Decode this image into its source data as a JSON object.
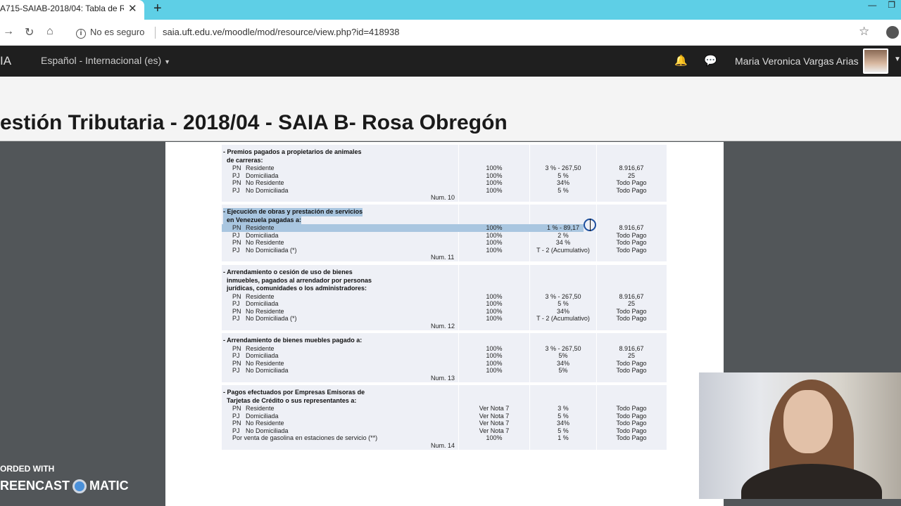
{
  "browser": {
    "tab_title": "A715-SAIAB-2018/04: Tabla de R",
    "secure_label": "No es seguro",
    "url": "saia.uft.edu.ve/moodle/mod/resource/view.php?id=418938"
  },
  "navbar": {
    "brand": "IA",
    "language": "Español - Internacional (es)",
    "user_name": "Maria Veronica Vargas Arias"
  },
  "course": {
    "title": "estión Tributaria - 2018/04 - SAIA B- Rosa Obregón"
  },
  "document": {
    "blocks": [
      {
        "heading": [
          "- Premios pagados a propietarios de animales",
          "de carreras:"
        ],
        "rows": [
          {
            "pfx": "PN",
            "label": "Residente",
            "c1": "100%",
            "c2": "3  %  - 267,50",
            "c3": "8.916,67"
          },
          {
            "pfx": "PJ",
            "label": "Domiciliada",
            "c1": "100%",
            "c2": "5  %",
            "c3": "25"
          },
          {
            "pfx": "PN",
            "label": "No Residente",
            "c1": "100%",
            "c2": "34%",
            "c3": "Todo Pago"
          },
          {
            "pfx": "PJ",
            "label": "No Domiciliada",
            "c1": "100%",
            "c2": "5  %",
            "c3": "Todo Pago"
          }
        ],
        "num": "Num. 10"
      },
      {
        "heading": [
          "- Ejecución de obras y prestación de servicios",
          "en Venezuela pagadas a:"
        ],
        "rows": [
          {
            "pfx": "PN",
            "label": "Residente",
            "c1": "100%",
            "c2": "1 %  - 89,17",
            "c3": "8.916,67"
          },
          {
            "pfx": "PJ",
            "label": "Domiciliada",
            "c1": "100%",
            "c2": "2  %",
            "c3": "Todo Pago"
          },
          {
            "pfx": "PN",
            "label": "No Residente",
            "c1": "100%",
            "c2": "34 %",
            "c3": "Todo Pago"
          },
          {
            "pfx": "PJ",
            "label": "No Domiciliada     (*)",
            "c1": "100%",
            "c2": "T  - 2 (Acumulativo)",
            "c3": "Todo Pago"
          }
        ],
        "num": "Num. 11"
      },
      {
        "heading": [
          "- Arrendamiento o cesión de uso de bienes",
          "inmuebles, pagados al arrendador por personas",
          "jurídicas, comunidades o los administradores:"
        ],
        "rows": [
          {
            "pfx": "PN",
            "label": "Residente",
            "c1": "100%",
            "c2": "3  %  - 267,50",
            "c3": "8.916,67"
          },
          {
            "pfx": "PJ",
            "label": "Domiciliada",
            "c1": "100%",
            "c2": "5  %",
            "c3": "25"
          },
          {
            "pfx": "PN",
            "label": "No Residente",
            "c1": "100%",
            "c2": "34%",
            "c3": "Todo Pago"
          },
          {
            "pfx": "PJ",
            "label": "No Domiciliada     (*)",
            "c1": "100%",
            "c2": "T  - 2 (Acumulativo)",
            "c3": "Todo Pago"
          }
        ],
        "num": "Num. 12"
      },
      {
        "heading": [
          "- Arrendamiento de bienes muebles pagado a:"
        ],
        "rows": [
          {
            "pfx": "PN",
            "label": "Residente",
            "c1": "100%",
            "c2": "3  %  - 267,50",
            "c3": "8.916,67"
          },
          {
            "pfx": "PJ",
            "label": "Domiciliada",
            "c1": "100%",
            "c2": "5%",
            "c3": "25"
          },
          {
            "pfx": "PN",
            "label": "No Residente",
            "c1": "100%",
            "c2": "34%",
            "c3": "Todo Pago"
          },
          {
            "pfx": "PJ",
            "label": "No Domiciliada",
            "c1": "100%",
            "c2": "5%",
            "c3": "Todo Pago"
          }
        ],
        "num": "Num. 13"
      },
      {
        "heading": [
          "- Pagos efectuados por Empresas Emisoras de",
          "Tarjetas de Crédito o sus representantes a:"
        ],
        "rows": [
          {
            "pfx": "PN",
            "label": "Residente",
            "c1": "Ver Nota 7",
            "c2": "3  %",
            "c3": "Todo Pago"
          },
          {
            "pfx": "PJ",
            "label": "Domiciliada",
            "c1": "Ver Nota 7",
            "c2": "5  %",
            "c3": "Todo Pago"
          },
          {
            "pfx": "PN",
            "label": "No Residente",
            "c1": "Ver Nota 7",
            "c2": "34%",
            "c3": "Todo Pago"
          },
          {
            "pfx": "PJ",
            "label": "No Domiciliada",
            "c1": "Ver Nota 7",
            "c2": "5  %",
            "c3": "Todo Pago"
          },
          {
            "pfx": "",
            "label": "Por venta de gasolina en estaciones de servicio (**)",
            "c1": "100%",
            "c2": "1  %",
            "c3": "Todo Pago"
          }
        ],
        "num": "Num. 14"
      }
    ]
  },
  "watermark": {
    "line1": "ORDED WITH",
    "line2_a": "REENCAST",
    "line2_b": "MATIC"
  }
}
